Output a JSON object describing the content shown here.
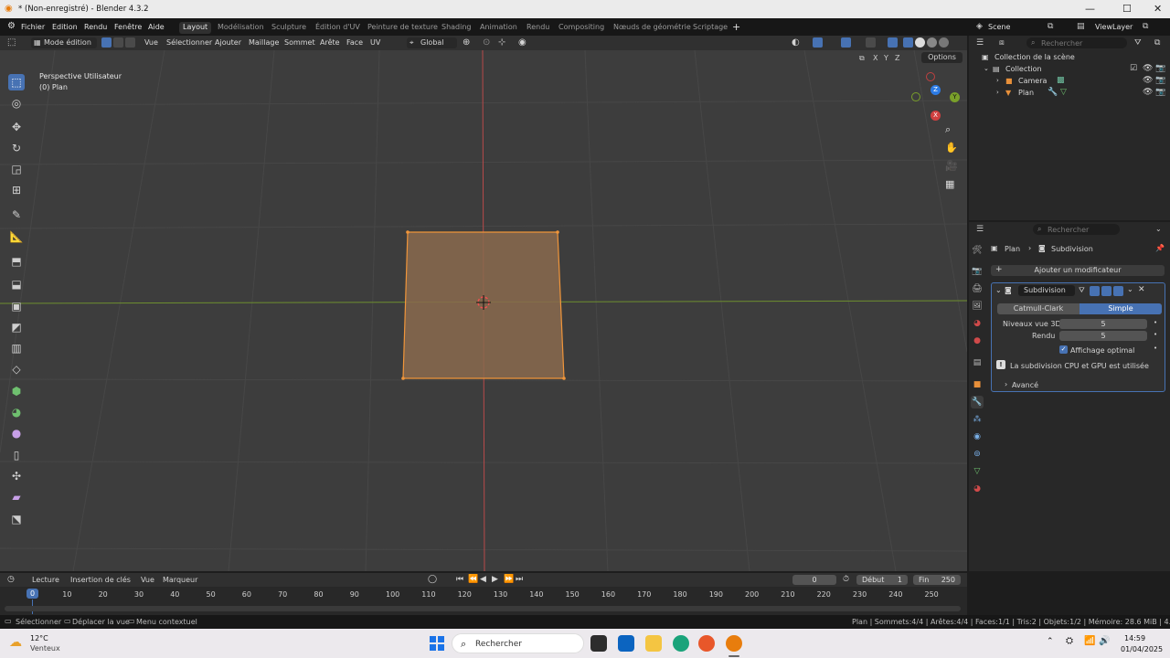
{
  "window": {
    "title": "* (Non-enregistré) - Blender 4.3.2",
    "minimize": "—",
    "maximize": "☐",
    "close": "✕"
  },
  "menus": [
    "Fichier",
    "Edition",
    "Rendu",
    "Fenêtre",
    "Aide"
  ],
  "workspaces": [
    "Layout",
    "Modélisation",
    "Sculpture",
    "Édition d'UV",
    "Peinture de texture",
    "Shading",
    "Animation",
    "Rendu",
    "Compositing",
    "Nœuds de géométrie",
    "Scriptage"
  ],
  "workspace_add": "+",
  "scene": {
    "label": "Scene",
    "viewlayer": "ViewLayer"
  },
  "viewport_header": {
    "mode": "Mode édition",
    "menus": [
      "Vue",
      "Sélectionner",
      "Ajouter",
      "Maillage",
      "Sommet",
      "Arête",
      "Face",
      "UV"
    ],
    "orientation": "Global",
    "options": "Options",
    "axes": [
      "X",
      "Y",
      "Z"
    ]
  },
  "viewport": {
    "view_name": "Perspective Utilisateur",
    "object_name": "(0) Plan"
  },
  "gizmo": {
    "x": "X",
    "y": "Y",
    "z": "Z"
  },
  "outliner": {
    "search_placeholder": "Rechercher",
    "scene_collection": "Collection de la scène",
    "collection": "Collection",
    "items": [
      "Camera",
      "Plan"
    ]
  },
  "properties": {
    "search_placeholder": "Rechercher",
    "breadcrumb_object": "Plan",
    "breadcrumb_modifier": "Subdivision",
    "add_modifier": "Ajouter un modificateur",
    "modifier_name": "Subdivision",
    "type_options": [
      "Catmull-Clark",
      "Simple"
    ],
    "selected_type": "Simple",
    "levels_viewport_label": "Niveaux vue 3D",
    "levels_viewport_value": "5",
    "render_label": "Rendu",
    "render_value": "5",
    "optimal_display": "Affichage optimal",
    "info_text": "La subdivision CPU et GPU est utilisée",
    "advanced": "Avancé"
  },
  "timeline": {
    "menus": [
      "Lecture",
      "Insertion de clés",
      "Vue",
      "Marqueur"
    ],
    "current_frame": "0",
    "start_label": "Début",
    "start_value": "1",
    "end_label": "Fin",
    "end_value": "250",
    "frame_marker": "0",
    "ticks": [
      "10",
      "20",
      "30",
      "40",
      "50",
      "60",
      "70",
      "80",
      "90",
      "100",
      "110",
      "120",
      "130",
      "140",
      "150",
      "160",
      "170",
      "180",
      "190",
      "200",
      "210",
      "220",
      "230",
      "240",
      "250"
    ]
  },
  "statusbar": {
    "select": "Sélectionner",
    "move_view": "Déplacer la vue",
    "context_menu": "Menu contextuel",
    "stats": "Plan | Sommets:4/4 | Arêtes:4/4 | Faces:1/1 | Tris:2 | Objets:1/2 | Mémoire: 28.6 MiB | 4.3.2"
  },
  "taskbar": {
    "weather_temp": "12°C",
    "weather_desc": "Venteux",
    "search_placeholder": "Rechercher",
    "time": "14:59",
    "date": "01/04/2025"
  },
  "colors": {
    "accent": "#4772b3",
    "selection_orange": "#f0953a",
    "x_axis": "#c84040",
    "y_axis": "#7aa02a"
  }
}
